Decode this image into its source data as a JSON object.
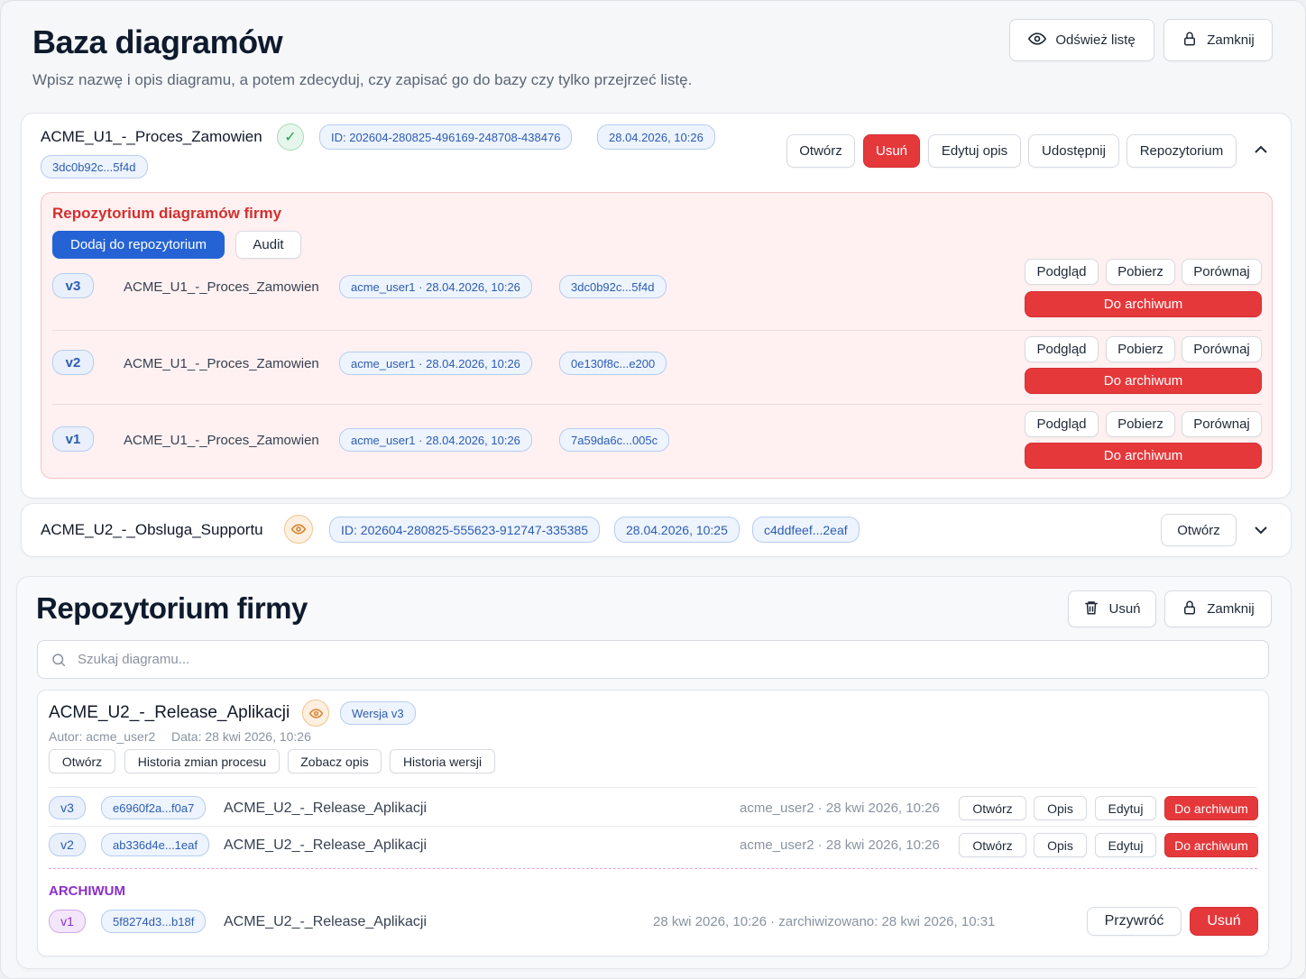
{
  "header": {
    "title": "Baza diagramów",
    "subtitle": "Wpisz nazwę i opis diagramu, a potem zdecyduj, czy zapisać go do bazy czy tylko przejrzeć listę.",
    "refresh_label": "Odśwież listę",
    "close_label": "Zamknij"
  },
  "diagram1": {
    "name": "ACME_U1_-_Proces_Zamowien",
    "id": "ID: 202604-280825-496169-248708-438476",
    "date": "28.04.2026, 10:26",
    "hash": "3dc0b92c...5f4d",
    "actions": {
      "open": "Otwórz",
      "delete": "Usuń",
      "edit": "Edytuj opis",
      "share": "Udostępnij",
      "repo": "Repozytorium"
    },
    "repo_panel": {
      "title": "Repozytorium diagramów firmy",
      "add_label": "Dodaj do repozytorium",
      "audit_label": "Audit",
      "versions": [
        {
          "ver": "v3",
          "name": "ACME_U1_-_Proces_Zamowien",
          "author": "acme_user1 · 28.04.2026, 10:26",
          "hash": "3dc0b92c...5f4d",
          "preview": "Podgląd",
          "download": "Pobierz",
          "compare": "Porównaj",
          "archive": "Do archiwum"
        },
        {
          "ver": "v2",
          "name": "ACME_U1_-_Proces_Zamowien",
          "author": "acme_user1 · 28.04.2026, 10:26",
          "hash": "0e130f8c...e200",
          "preview": "Podgląd",
          "download": "Pobierz",
          "compare": "Porównaj",
          "archive": "Do archiwum"
        },
        {
          "ver": "v1",
          "name": "ACME_U1_-_Proces_Zamowien",
          "author": "acme_user1 · 28.04.2026, 10:26",
          "hash": "7a59da6c...005c",
          "preview": "Podgląd",
          "download": "Pobierz",
          "compare": "Porównaj",
          "archive": "Do archiwum"
        }
      ]
    }
  },
  "diagram2": {
    "name": "ACME_U2_-_Obsluga_Supportu",
    "id": "ID: 202604-280825-555623-912747-335385",
    "date": "28.04.2026, 10:25",
    "hash": "c4ddfeef...2eaf",
    "open": "Otwórz"
  },
  "repository": {
    "title": "Repozytorium firmy",
    "delete_label": "Usuń",
    "close_label": "Zamknij",
    "search_placeholder": "Szukaj diagramu...",
    "item": {
      "name": "ACME_U2_-_Release_Aplikacji",
      "version_badge": "Wersja v3",
      "author": "Autor: acme_user2",
      "date": "Data: 28 kwi 2026, 10:26",
      "actions": {
        "open": "Otwórz",
        "history": "Historia zmian procesu",
        "desc": "Zobacz opis",
        "versions": "Historia wersji"
      },
      "versions": [
        {
          "ver": "v3",
          "hash": "e6960f2a...f0a7",
          "name": "ACME_U2_-_Release_Aplikacji",
          "meta": "acme_user2 · 28 kwi 2026, 10:26",
          "open": "Otwórz",
          "desc": "Opis",
          "edit": "Edytuj",
          "archive": "Do archiwum"
        },
        {
          "ver": "v2",
          "hash": "ab336d4e...1eaf",
          "name": "ACME_U2_-_Release_Aplikacji",
          "meta": "acme_user2 · 28 kwi 2026, 10:26",
          "open": "Otwórz",
          "desc": "Opis",
          "edit": "Edytuj",
          "archive": "Do archiwum"
        }
      ],
      "archive": {
        "label": "ARCHIWUM",
        "ver": "v1",
        "hash": "5f8274d3...b18f",
        "name": "ACME_U2_-_Release_Aplikacji",
        "meta": "28 kwi 2026, 10:26 · zarchiwizowano: 28 kwi 2026, 10:31",
        "restore": "Przywróć",
        "delete": "Usuń"
      }
    }
  },
  "colors": {
    "accent_blue": "#2563d4",
    "danger_red": "#e5383b",
    "archive_purple": "#8b2fc9",
    "repo_panel_bg": "#fff1f1"
  }
}
